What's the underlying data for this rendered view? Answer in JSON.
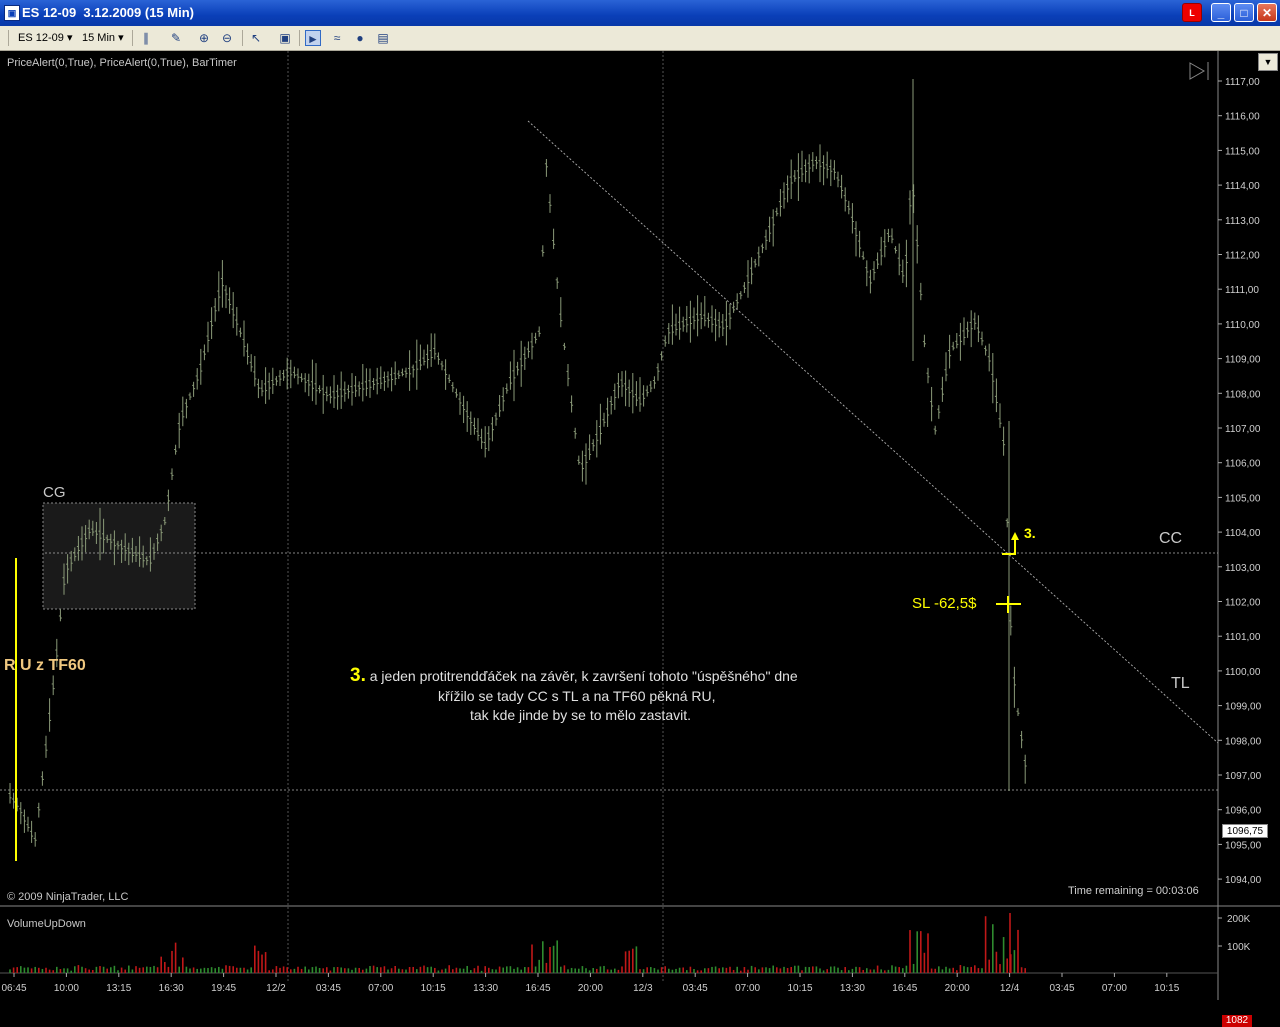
{
  "window": {
    "title": "ES 12-09  3.12.2009 (15 Min)",
    "icon_label": "▣",
    "alert_label": "L",
    "minimize": "_",
    "maximize": "□",
    "close": "✕"
  },
  "toolbar": {
    "instrument": "ES 12-09",
    "interval": "15 Min"
  },
  "chart": {
    "indicators_label": "PriceAlert(0,True), PriceAlert(0,True), BarTimer",
    "copyright": "© 2009 NinjaTrader, LLC",
    "time_remaining": "Time remaining = 00:03:06",
    "volume_label": "VolumeUpDown",
    "price_axis": [
      "1117,00",
      "1116,00",
      "1115,00",
      "1114,00",
      "1113,00",
      "1112,00",
      "1111,00",
      "1110,00",
      "1109,00",
      "1108,00",
      "1107,00",
      "1106,00",
      "1105,00",
      "1104,00",
      "1103,00",
      "1102,00",
      "1101,00",
      "1100,00",
      "1099,00",
      "1098,00",
      "1097,00",
      "1096,00",
      "1095,00",
      "1094,00"
    ],
    "current_price": "1096,75",
    "volume_axis": [
      "200K",
      "100K"
    ],
    "current_volume": "1082",
    "time_axis": [
      "06:45",
      "10:00",
      "13:15",
      "16:30",
      "19:45",
      "12/2",
      "03:45",
      "07:00",
      "10:15",
      "13:30",
      "16:45",
      "20:00",
      "12/3",
      "03:45",
      "07:00",
      "10:15",
      "13:30",
      "16:45",
      "20:00",
      "12/4",
      "03:45",
      "07:00",
      "10:15"
    ],
    "colors": {
      "bars": "#8a9a78",
      "annotation": "#ffff00",
      "guide": "#b0b0b0",
      "vol_up": "#2e8b2e",
      "vol_down": "#c01818"
    }
  },
  "annotations": {
    "cg": "CG",
    "cc": "CC",
    "tl": "TL",
    "ru": "R U z TF60",
    "sl": "SL -62,5$",
    "marker": "3.",
    "note_number": "3.",
    "note_line1": " a jeden protitrendďáček na závěr, k završení tohoto \"úspěšného\" dne",
    "note_line2": "křížilo se tady CC s TL a na TF60 pěkná RU,",
    "note_line3": "tak kde jinde by se to mělo zastavit."
  }
}
